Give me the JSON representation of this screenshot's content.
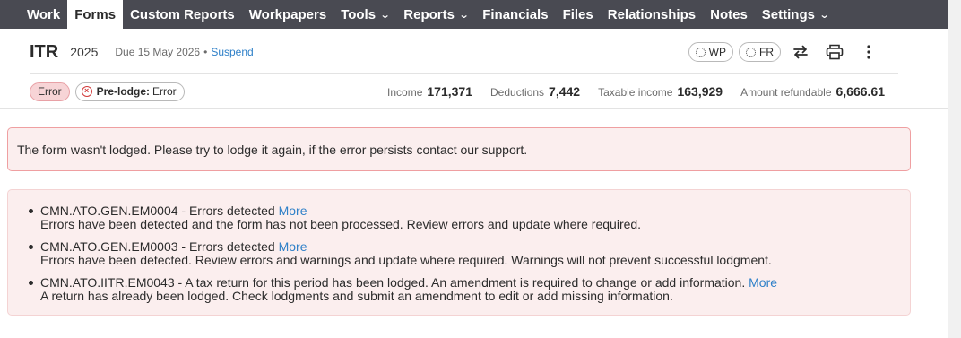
{
  "nav": {
    "items": [
      {
        "label": "Work",
        "dropdown": false
      },
      {
        "label": "Forms",
        "dropdown": false,
        "active": true
      },
      {
        "label": "Custom Reports",
        "dropdown": false
      },
      {
        "label": "Workpapers",
        "dropdown": false
      },
      {
        "label": "Tools",
        "dropdown": true
      },
      {
        "label": "Reports",
        "dropdown": true
      },
      {
        "label": "Financials",
        "dropdown": false
      },
      {
        "label": "Files",
        "dropdown": false
      },
      {
        "label": "Relationships",
        "dropdown": false
      },
      {
        "label": "Notes",
        "dropdown": false
      },
      {
        "label": "Settings",
        "dropdown": true
      }
    ]
  },
  "header": {
    "form_name": "ITR",
    "year": "2025",
    "due": "Due 15 May 2026",
    "separator": "•",
    "suspend_label": "Suspend",
    "wp_label": "WP",
    "fr_label": "FR"
  },
  "status": {
    "error_badge": "Error",
    "prelodge_label": "Pre-lodge:",
    "prelodge_value": "Error"
  },
  "metrics": [
    {
      "label": "Income",
      "value": "171,371"
    },
    {
      "label": "Deductions",
      "value": "7,442"
    },
    {
      "label": "Taxable income",
      "value": "163,929"
    },
    {
      "label": "Amount refundable",
      "value": "6,666.61"
    }
  ],
  "alert": {
    "message": "The form wasn't lodged. Please try to lodge it again, if the error persists contact our support."
  },
  "errors": [
    {
      "code_title": "CMN.ATO.GEN.EM0004 - Errors detected",
      "more": "More",
      "detail": "Errors have been detected and the form has not been processed. Review errors and update where required."
    },
    {
      "code_title": "CMN.ATO.GEN.EM0003 - Errors detected",
      "more": "More",
      "detail": "Errors have been detected. Review errors and warnings and update where required. Warnings will not prevent successful lodgment."
    },
    {
      "code_title": "CMN.ATO.IITR.EM0043 - A tax return for this period has been lodged. An amendment is required to change or add information.",
      "more": "More",
      "detail": "A return has already been lodged. Check lodgments and submit an amendment to edit or add missing information."
    }
  ],
  "colors": {
    "nav_bg": "#494a52",
    "link": "#2f80c8",
    "error_bg": "#fbeeee",
    "error_border": "#ef9fa1",
    "error_badge_bg": "#f7d4d6"
  }
}
